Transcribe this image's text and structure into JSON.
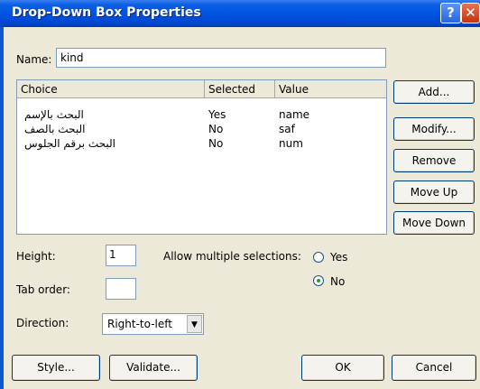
{
  "window": {
    "title": "Drop-Down Box Properties",
    "help_glyph": "?",
    "close_glyph": "✕"
  },
  "name_field": {
    "label": "Name:",
    "value": "kind"
  },
  "choices": {
    "headers": [
      "Choice",
      "Selected",
      "Value"
    ],
    "rows": [
      {
        "choice": "البحث بالإسم",
        "selected": "Yes",
        "value": "name"
      },
      {
        "choice": "البحث بالصف",
        "selected": "No",
        "value": "saf"
      },
      {
        "choice": "البحث برقم الجلوس",
        "selected": "No",
        "value": "num"
      }
    ]
  },
  "side_buttons": {
    "add": "Add...",
    "modify": "Modify...",
    "remove": "Remove",
    "move_up": "Move Up",
    "move_down": "Move Down"
  },
  "height_field": {
    "label": "Height:",
    "value": "1"
  },
  "tab_order_field": {
    "label": "Tab order:",
    "value": ""
  },
  "allow_multiple": {
    "label": "Allow multiple selections:",
    "yes_label": "Yes",
    "no_label": "No",
    "selected": "No"
  },
  "direction": {
    "label": "Direction:",
    "value": "Right-to-left"
  },
  "bottom_buttons": {
    "style": "Style...",
    "validate": "Validate...",
    "ok": "OK",
    "cancel": "Cancel"
  },
  "colors": {
    "title_bar": "#0054e3",
    "dialog_bg": "#ece9d8",
    "radio_dot": "#21a121"
  }
}
